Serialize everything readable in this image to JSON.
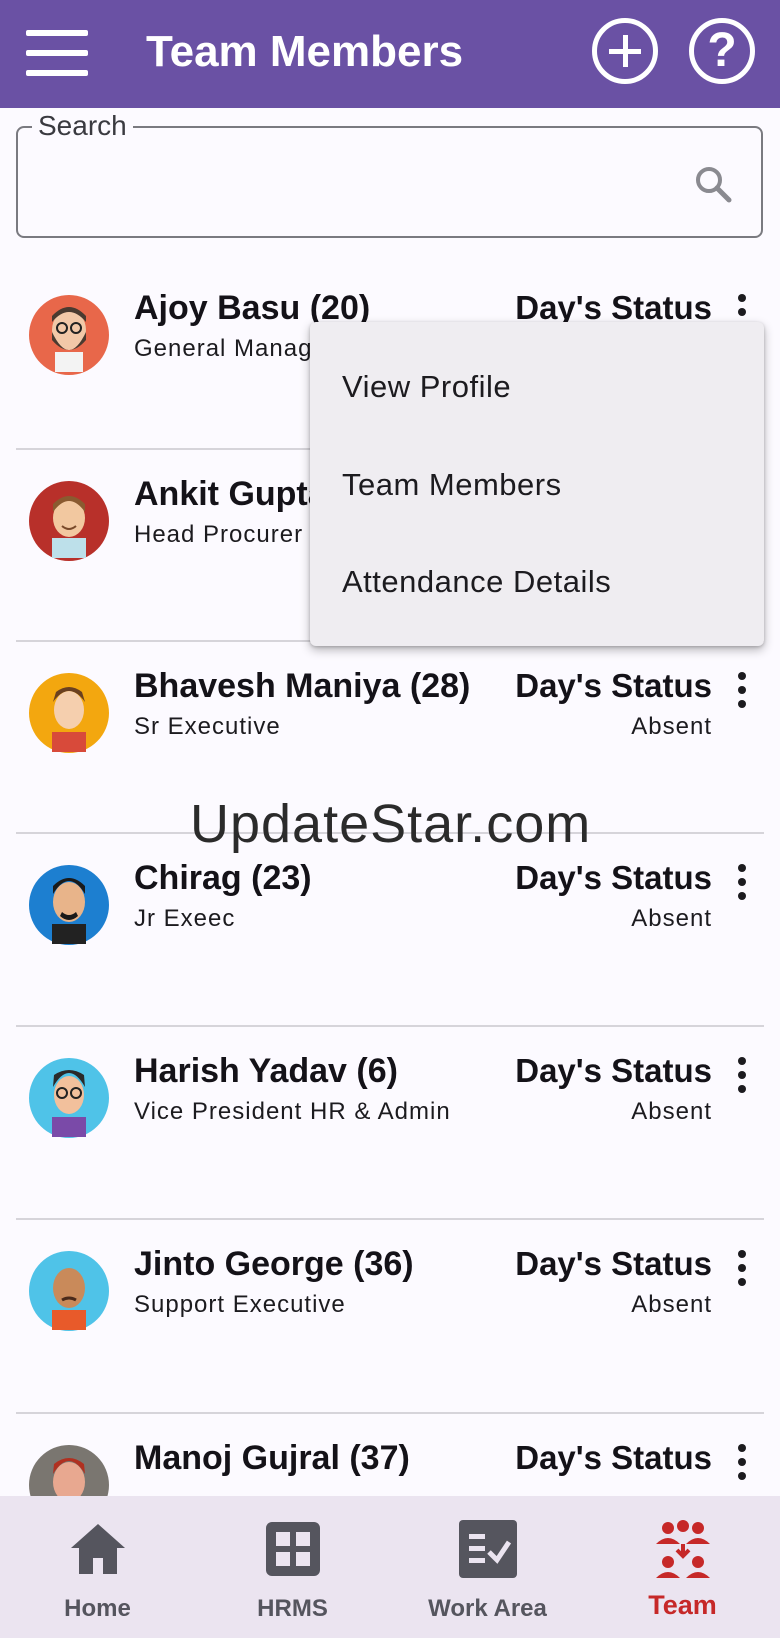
{
  "appbar": {
    "title": "Team Members"
  },
  "search": {
    "label": "Search"
  },
  "members": [
    {
      "name": "Ajoy Basu (20)",
      "role": "General Manag",
      "status_label": "Day's Status",
      "status_value": ""
    },
    {
      "name": "Ankit Gupta",
      "role": "Head Procurer",
      "status_label": "",
      "status_value": ""
    },
    {
      "name": "Bhavesh Maniya (28)",
      "role": "Sr Executive",
      "status_label": "Day's Status",
      "status_value": "Absent"
    },
    {
      "name": "Chirag (23)",
      "role": "Jr Exeec",
      "status_label": "Day's Status",
      "status_value": "Absent"
    },
    {
      "name": "Harish Yadav (6)",
      "role": "Vice President HR & Admin",
      "status_label": "Day's Status",
      "status_value": "Absent"
    },
    {
      "name": "Jinto George (36)",
      "role": "Support Executive",
      "status_label": "Day's Status",
      "status_value": "Absent"
    },
    {
      "name": "Manoj Gujral (37)",
      "role": "",
      "status_label": "Day's Status",
      "status_value": ""
    }
  ],
  "popup_menu": {
    "items": [
      "View Profile",
      "Team Members",
      "Attendance Details"
    ]
  },
  "watermark": "UpdateStar.com",
  "bottom_nav": {
    "items": [
      {
        "label": "Home",
        "icon": "home-icon"
      },
      {
        "label": "HRMS",
        "icon": "grid-icon"
      },
      {
        "label": "Work Area",
        "icon": "checklist-icon"
      },
      {
        "label": "Team",
        "icon": "team-icon"
      }
    ],
    "active": "Team"
  },
  "colors": {
    "appbar": "#6a51a4",
    "active_nav": "#c62828",
    "background": "#fcfaff"
  }
}
